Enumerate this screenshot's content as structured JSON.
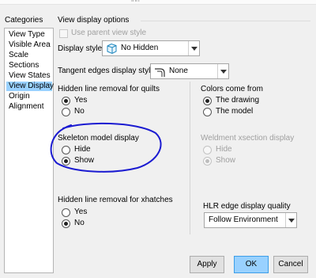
{
  "window": {
    "title_fragment": "ing"
  },
  "categories": {
    "heading": "Categories",
    "items": [
      {
        "label": "View Type",
        "selected": false
      },
      {
        "label": "Visible Area",
        "selected": false
      },
      {
        "label": "Scale",
        "selected": false
      },
      {
        "label": "Sections",
        "selected": false
      },
      {
        "label": "View States",
        "selected": false
      },
      {
        "label": "View Display",
        "selected": true
      },
      {
        "label": "Origin",
        "selected": false
      },
      {
        "label": "Alignment",
        "selected": false
      }
    ]
  },
  "options": {
    "group_title": "View display options",
    "use_parent_view_style": {
      "label": "Use parent view style",
      "checked": false,
      "enabled": false
    },
    "display_style": {
      "label": "Display style",
      "value": "No Hidden",
      "icon": "no-hidden-cube-icon"
    },
    "tangent_edges": {
      "label": "Tangent edges display style",
      "value": "None",
      "icon": "tangent-edge-icon"
    },
    "hidden_line_quilts": {
      "label": "Hidden line removal for quilts",
      "options": [
        "Yes",
        "No"
      ],
      "selected": "Yes"
    },
    "skeleton_model": {
      "label": "Skeleton model display",
      "options": [
        "Hide",
        "Show"
      ],
      "selected": "Show",
      "annotation_color": "#1b1bd1"
    },
    "hidden_line_xhatches": {
      "label": "Hidden line removal for xhatches",
      "options": [
        "Yes",
        "No"
      ],
      "selected": "No"
    },
    "colors_from": {
      "label": "Colors come from",
      "options": [
        "The drawing",
        "The model"
      ],
      "selected": "The drawing"
    },
    "weldment_xsection": {
      "label": "Weldment xsection display",
      "options": [
        "Hide",
        "Show"
      ],
      "selected": "Show",
      "enabled": false
    },
    "hlr_edge_quality": {
      "label": "HLR edge display quality",
      "value": "Follow Environment"
    }
  },
  "buttons": {
    "apply": "Apply",
    "ok": "OK",
    "cancel": "Cancel"
  },
  "colors": {
    "selection": "#99d1ff",
    "default_button_border": "#3c9ee8"
  }
}
